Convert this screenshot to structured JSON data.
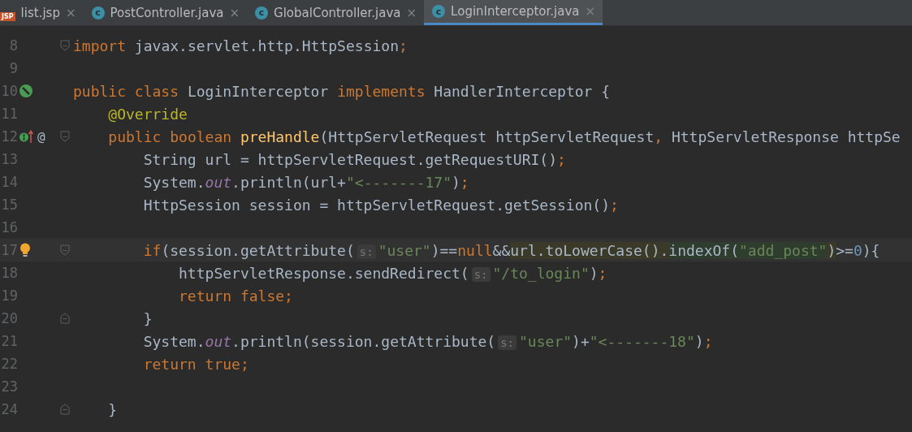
{
  "tabs": [
    {
      "label": "list.jsp",
      "kind": "jsp",
      "icon_text": "JSP",
      "close": "×",
      "selected": false
    },
    {
      "label": "PostController.java",
      "kind": "class",
      "icon_text": "c",
      "close": "×",
      "selected": false
    },
    {
      "label": "GlobalController.java",
      "kind": "class",
      "icon_text": "c",
      "close": "×",
      "selected": false
    },
    {
      "label": "LoginInterceptor.java",
      "kind": "class",
      "icon_text": "c",
      "close": "×",
      "selected": true
    }
  ],
  "lines": [
    {
      "number": "8",
      "markers": [
        {
          "kind": "fold-start"
        }
      ],
      "tokens": [
        {
          "text": "import",
          "kind": "keyword"
        },
        {
          "text": " javax.servlet.http.HttpSession",
          "kind": "plain"
        },
        {
          "text": ";",
          "kind": "keyword"
        }
      ]
    },
    {
      "number": "9"
    },
    {
      "number": "10",
      "markers": [
        {
          "kind": "implemented"
        }
      ],
      "tokens": [
        {
          "text": "public class",
          "kind": "keyword"
        },
        {
          "text": " LoginInterceptor ",
          "kind": "plain"
        },
        {
          "text": "implements",
          "kind": "keyword"
        },
        {
          "text": " HandlerInterceptor {",
          "kind": "plain"
        }
      ],
      "children": [
        {
          "number": "11",
          "tokens": [
            {
              "text": "@Override",
              "kind": "annotation"
            }
          ]
        },
        {
          "number": "12",
          "markers": [
            {
              "kind": "override"
            },
            {
              "kind": "annotation",
              "text": "@"
            },
            {
              "kind": "fold-start"
            }
          ],
          "tokens": [
            {
              "text": "public boolean ",
              "kind": "keyword"
            },
            {
              "text": "preHandle",
              "kind": "method"
            },
            {
              "text": "(HttpServletRequest httpServletRequest",
              "kind": "plain"
            },
            {
              "text": ",",
              "kind": "keyword"
            },
            {
              "text": " HttpServletResponse httpSe",
              "kind": "plain"
            }
          ],
          "children": [
            {
              "number": "13",
              "tokens": [
                {
                  "text": "String url = httpServletRequest.getRequestURI()",
                  "kind": "plain"
                },
                {
                  "text": ";",
                  "kind": "keyword"
                }
              ]
            },
            {
              "number": "14",
              "tokens": [
                {
                  "text": "System.",
                  "kind": "plain"
                },
                {
                  "text": "out",
                  "kind": "static"
                },
                {
                  "text": ".println(url+",
                  "kind": "plain"
                },
                {
                  "text": "\"<-------17\"",
                  "kind": "string"
                },
                {
                  "text": ")",
                  "kind": "plain"
                },
                {
                  "text": ";",
                  "kind": "keyword"
                }
              ]
            },
            {
              "number": "15",
              "tokens": [
                {
                  "text": "HttpSession session = httpServletRequest.getSession()",
                  "kind": "plain"
                },
                {
                  "text": ";",
                  "kind": "keyword"
                }
              ]
            },
            {
              "number": "16"
            },
            {
              "number": "17",
              "current": true,
              "markers": [
                {
                  "kind": "bulb"
                },
                {
                  "kind": "fold-start"
                }
              ],
              "tokens": [
                {
                  "text": "if",
                  "kind": "keyword"
                },
                {
                  "text": "(session.getAttribute(",
                  "kind": "plain"
                },
                {
                  "text": "s:",
                  "kind": "hint"
                },
                {
                  "text": "\"user\"",
                  "kind": "string"
                },
                {
                  "text": ")==",
                  "kind": "plain"
                },
                {
                  "text": "null",
                  "kind": "keyword"
                },
                {
                  "text": "&&",
                  "kind": "plain"
                },
                {
                  "text": "url.toLowerCase().",
                  "kind": "plain-usage"
                },
                {
                  "text": "indexOf(",
                  "kind": "plain-range"
                },
                {
                  "text": "\"add_post\"",
                  "kind": "string-range"
                },
                {
                  "text": ")",
                  "kind": "plain-usage"
                },
                {
                  "text": ">=",
                  "kind": "plain"
                },
                {
                  "text": "0",
                  "kind": "number"
                },
                {
                  "text": "){",
                  "kind": "plain"
                }
              ],
              "children": [
                {
                  "number": "18",
                  "tokens": [
                    {
                      "text": "httpServletResponse.sendRedirect(",
                      "kind": "plain"
                    },
                    {
                      "text": "s:",
                      "kind": "hint"
                    },
                    {
                      "text": "\"/to_login\"",
                      "kind": "string"
                    },
                    {
                      "text": ")",
                      "kind": "plain"
                    },
                    {
                      "text": ";",
                      "kind": "keyword"
                    }
                  ]
                },
                {
                  "number": "19",
                  "tokens": [
                    {
                      "text": "return false;",
                      "kind": "keyword"
                    }
                  ]
                }
              ]
            },
            {
              "number": "20",
              "markers": [
                {
                  "kind": "fold-end"
                }
              ],
              "tokens": [
                {
                  "text": "}",
                  "kind": "plain"
                }
              ]
            },
            {
              "number": "21",
              "tokens": [
                {
                  "text": "System.",
                  "kind": "plain"
                },
                {
                  "text": "out",
                  "kind": "static"
                },
                {
                  "text": ".println(session.getAttribute(",
                  "kind": "plain"
                },
                {
                  "text": "s:",
                  "kind": "hint"
                },
                {
                  "text": "\"user\"",
                  "kind": "string"
                },
                {
                  "text": ")+",
                  "kind": "plain"
                },
                {
                  "text": "\"<-------18\"",
                  "kind": "string"
                },
                {
                  "text": ")",
                  "kind": "plain"
                },
                {
                  "text": ";",
                  "kind": "keyword"
                }
              ]
            },
            {
              "number": "22",
              "tokens": [
                {
                  "text": "return true;",
                  "kind": "keyword"
                }
              ]
            },
            {
              "number": "23"
            }
          ]
        },
        {
          "number": "24",
          "markers": [
            {
              "kind": "fold-end"
            }
          ],
          "tokens": [
            {
              "text": "}",
              "kind": "plain"
            }
          ]
        }
      ]
    }
  ]
}
